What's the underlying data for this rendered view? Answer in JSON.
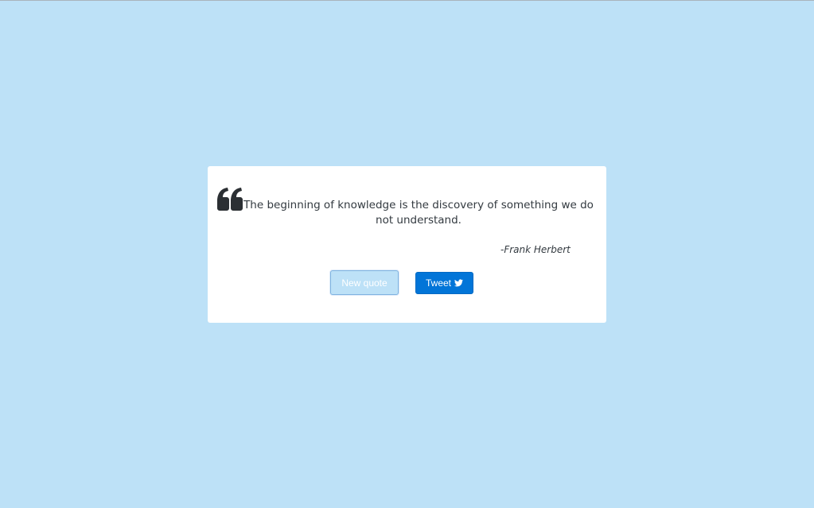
{
  "quote": {
    "text": "The beginning of knowledge is the discovery of something we do not understand.",
    "author": "-Frank Herbert"
  },
  "buttons": {
    "new_quote_label": "New quote",
    "tweet_label": "Tweet"
  },
  "icons": {
    "quote": "quote-left-icon",
    "tweet": "twitter-icon"
  },
  "colors": {
    "background": "#bde1f7",
    "card": "#ffffff",
    "text": "#333a40",
    "tweet_button": "#0275d8",
    "new_quote_button": "#bde1f7"
  }
}
